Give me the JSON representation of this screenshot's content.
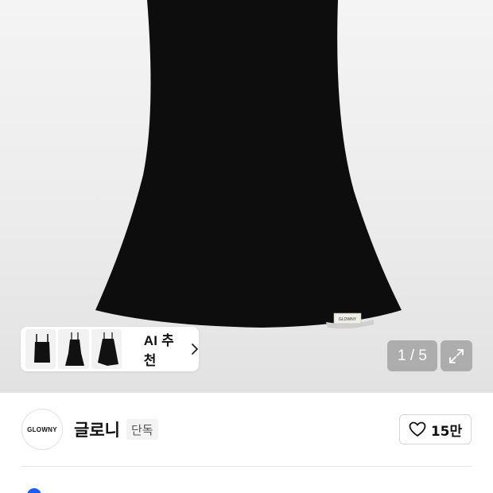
{
  "gallery": {
    "counter": "1 / 5",
    "dress_tag_text": "GLOWNY"
  },
  "ai_recommend": {
    "label": "AI 추천",
    "thumbnails": [
      "square-neck-top-icon",
      "cami-dress-icon",
      "asymmetric-skirt-icon"
    ]
  },
  "brand": {
    "logo_text": "GLOWNY",
    "name": "글로니",
    "tag": "단독"
  },
  "likes": {
    "count": "15만"
  },
  "colors": {
    "accent": "#1a5cf5",
    "product": "#111111"
  }
}
